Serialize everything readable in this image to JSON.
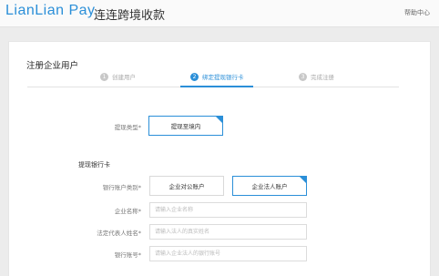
{
  "header": {
    "logo": "LianLian Pay",
    "title": "连连跨境收款",
    "help": "帮助中心"
  },
  "page": {
    "title": "注册企业用户"
  },
  "steps": [
    {
      "num": "1",
      "label": "创建用户"
    },
    {
      "num": "2",
      "label": "绑定提现银行卡"
    },
    {
      "num": "3",
      "label": "完成注册"
    }
  ],
  "withdraw_type": {
    "label": "提现类型*",
    "option": "提现至境内"
  },
  "bank_section": {
    "title": "提现银行卡"
  },
  "account_type": {
    "label": "银行账户类别*",
    "options": [
      "企业对公账户",
      "企业法人账户"
    ]
  },
  "fields": [
    {
      "label": "企业名称*",
      "placeholder": "请输入企业名称"
    },
    {
      "label": "法定代表人姓名*",
      "placeholder": "请输入法人的真实姓名"
    },
    {
      "label": "银行账号*",
      "placeholder": "请输入企业法人的银行账号"
    }
  ],
  "colors": {
    "accent": "#2b8fd8"
  }
}
